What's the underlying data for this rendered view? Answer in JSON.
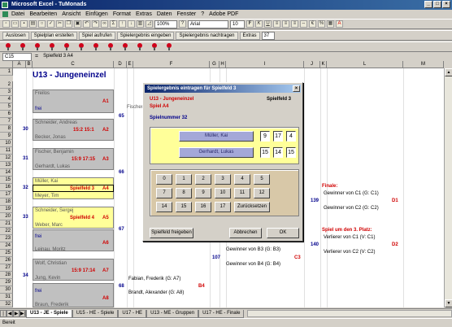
{
  "window": {
    "title": "Microsoft Excel - TuMonads",
    "min": "_",
    "max": "□",
    "close": "×"
  },
  "menu": [
    "Datei",
    "Bearbeiten",
    "Ansicht",
    "Einfügen",
    "Format",
    "Extras",
    "Daten",
    "Fenster",
    "?",
    "Adobe PDF"
  ],
  "toolbar2": {
    "zoom": "100%",
    "font": "Arial",
    "size": "10"
  },
  "toolbar3": {
    "b1": "Auslosen",
    "b2": "Spielplan erstellen",
    "b3": "Spiel aufrufen",
    "b4": "Spielergebnis eingeben",
    "b5": "Spielergebnis nachtragen",
    "b6": "Extras",
    "val": "37"
  },
  "formula": {
    "cell": "C15",
    "fx": "=",
    "content": "Spielfeld 3   A4"
  },
  "columns": [
    "A",
    "B",
    "C",
    "D",
    "E",
    "F",
    "G",
    "H",
    "I",
    "J",
    "K",
    "L",
    "M"
  ],
  "rows": [
    "1",
    "2",
    "3",
    "4",
    "5",
    "6",
    "7",
    "8",
    "9",
    "10",
    "11",
    "12",
    "13",
    "14",
    "15",
    "16",
    "17",
    "18",
    "19",
    "20",
    "21",
    "22",
    "23",
    "24",
    "25",
    "26",
    "27",
    "28",
    "29",
    "30",
    "31",
    "32"
  ],
  "sheet": {
    "title": "U13 - Jungeneinzel",
    "c2": "Freilos",
    "c3": "frei",
    "a1": "A1",
    "n30": "30",
    "m1": "Schneider, Andreas",
    "m1score": "15:2   15:1",
    "a2": "A2",
    "m2": "Becker, Jonas",
    "n31": "31",
    "m3": "Fischer, Benjamin",
    "m3score": "15:9   17:15",
    "a3": "A3",
    "m4": "Gerhardt, Lukas",
    "m5": "Müller, Kai",
    "m5field": "Spielfeld 3",
    "a4": "A4",
    "m6": "Meyer, Tim",
    "n32": "32",
    "m7": "Schneider, Sergej",
    "m7field": "Spielfeld 4",
    "a5": "A5",
    "n33": "33",
    "m8": "Weber, Marc",
    "c9": "frei",
    "a6": "A6",
    "m9": "Leinau, Moritz",
    "n34": "34",
    "m10": "Wolf, Christian",
    "m10score": "15:9   17:14",
    "a7": "A7",
    "m11": "Jung, Kevin",
    "c12": "frei",
    "a8": "A8",
    "m12": "Braun, Frederik",
    "n65": "65",
    "fs1": "Fischer, Benjamin",
    "n66": "66",
    "n67": "67",
    "n68": "68",
    "b4": "B4",
    "fs4a": "Fabian, Frederik  (G: A7)",
    "fs4b": "Brandt, Alexander  (G: A8)",
    "n107": "107",
    "win_b3": "Gewinner von B3  (G: B3)",
    "win_b4": "Gewinner von B4  (G: B4)",
    "c3x": "C3",
    "finale": "Finale:",
    "n139": "139",
    "f1": "Gewinner von C1  (G: C1)",
    "f2": "Gewinner von C2  (G: C2)",
    "d1": "D1",
    "platz3": "Spiel um den 3. Platz:",
    "n140": "140",
    "p1": "Verlierer von C1  (V: C1)",
    "p2": "Verlierer von C2  (V: C2)",
    "d2": "D2"
  },
  "dialog": {
    "title": "Spielergebnis eintragen für Spielfeld 3",
    "close": "×",
    "event": "U13 - Jungeneinzel",
    "field": "Spielfeld 3",
    "spiel": "Spiel  A4",
    "spielnummer": "Spielnummer  32",
    "player1": "Müller, Kai",
    "player2": "Gerhardt, Lukas",
    "p1scores": [
      "9",
      "17",
      "4"
    ],
    "p2scores": [
      "15",
      "14",
      "15"
    ],
    "keys": [
      [
        "0",
        "1",
        "2",
        "3",
        "4",
        "5"
      ],
      [
        "7",
        "8",
        "9",
        "10",
        "11",
        "12"
      ],
      [
        "14",
        "15",
        "16",
        "17"
      ]
    ],
    "reset": "Zurücksetzen",
    "release": "Spielfeld freigeben",
    "cancel": "Abbrechen",
    "ok": "OK"
  },
  "tabs": [
    "U13 - JE - Spiele",
    "U15 - HE - Spiele",
    "U17 - HE",
    "U13 - ME - Gruppen",
    "U17 - HE - Finale"
  ],
  "status": "Bereit"
}
